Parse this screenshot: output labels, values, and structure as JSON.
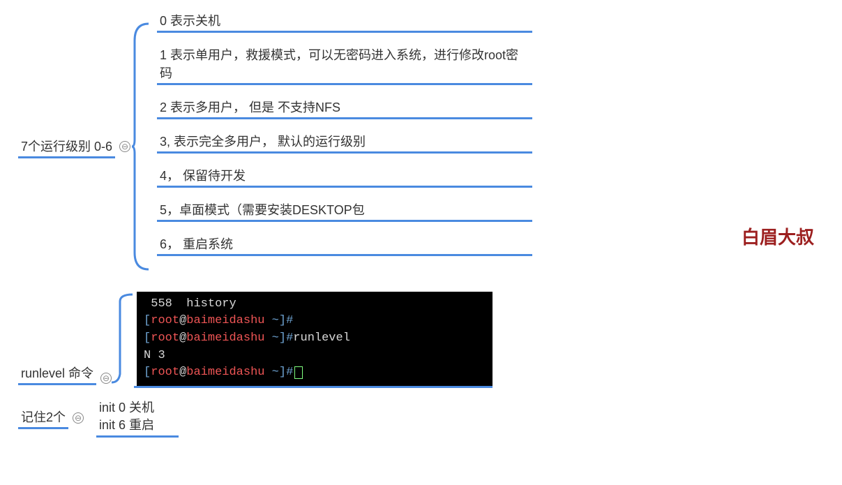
{
  "watermark": "白眉大叔",
  "branch1": {
    "label": "7个运行级别 0-6",
    "items": [
      "0 表示关机",
      "1 表示单用户，救援模式，可以无密码进入系统，进行修改root密码",
      "2 表示多用户， 但是 不支持NFS",
      "3, 表示完全多用户， 默认的运行级别",
      "4， 保留待开发",
      "5，卓面模式（需要安装DESKTOP包",
      "6， 重启系统"
    ]
  },
  "branch2": {
    "label": "runlevel 命令",
    "terminal": {
      "line1_num": "558",
      "line1_cmd": "history",
      "prompt_open": "[",
      "prompt_user": "root",
      "prompt_at": "@",
      "prompt_host": "baimeidashu",
      "prompt_tilde": " ~",
      "prompt_close": "]#",
      "cmd2": "runlevel",
      "output": "N 3"
    }
  },
  "branch3": {
    "label": "记住2个",
    "line1": "init 0 关机",
    "line2": "init 6 重启"
  },
  "toggle": "⊖"
}
